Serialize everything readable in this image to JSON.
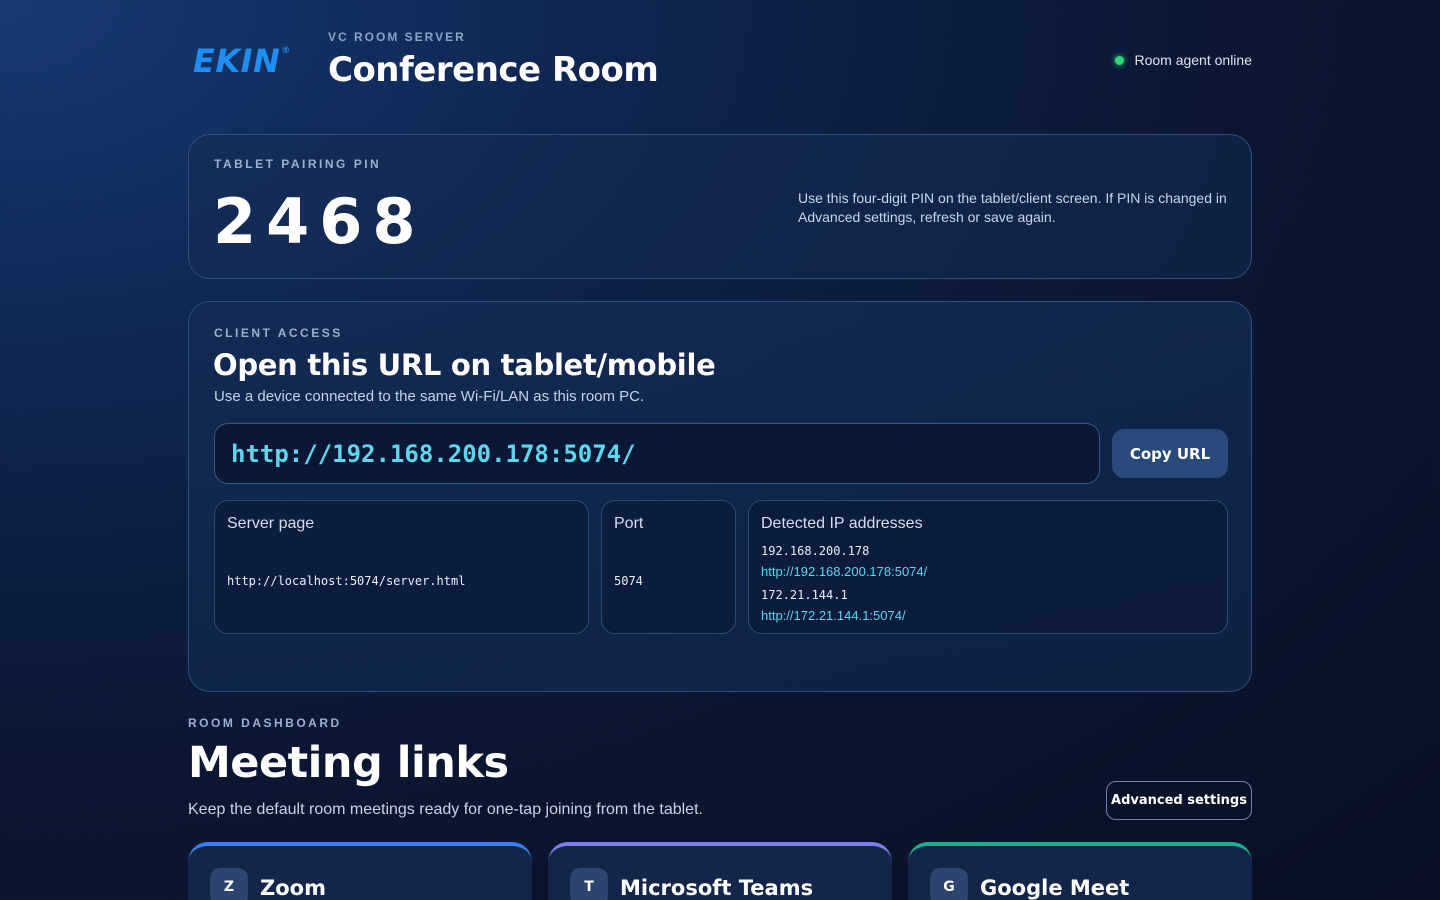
{
  "header": {
    "logo": "EKIN",
    "logo_mark": "®",
    "eyebrow": "VC ROOM SERVER",
    "title": "Conference Room",
    "status": "Room agent online",
    "status_color": "#2ed47a"
  },
  "pin": {
    "label": "TABLET PAIRING PIN",
    "value": "2468",
    "help": "Use this four-digit PIN on the tablet/client screen. If PIN is changed in Advanced settings, refresh or save again."
  },
  "access": {
    "label": "CLIENT ACCESS",
    "title": "Open this URL on tablet/mobile",
    "subtitle": "Use a device connected to the same Wi-Fi/LAN as this room PC.",
    "url": "http://192.168.200.178:5074/",
    "copy_label": "Copy URL",
    "server_page": {
      "title": "Server page",
      "value": "http://localhost:5074/server.html"
    },
    "port": {
      "title": "Port",
      "value": "5074"
    },
    "ips": {
      "title": "Detected IP addresses",
      "entries": [
        {
          "address": "192.168.200.178",
          "link": "http://192.168.200.178:5074/"
        },
        {
          "address": "172.21.144.1",
          "link": "http://172.21.144.1:5074/"
        }
      ]
    }
  },
  "dashboard": {
    "label": "ROOM DASHBOARD",
    "title": "Meeting links",
    "subtitle": "Keep the default room meetings ready for one-tap joining from the tablet.",
    "advanced_label": "Advanced settings",
    "meetings": [
      {
        "badge": "Z",
        "name": "Zoom",
        "accent": "#3b7ff5"
      },
      {
        "badge": "T",
        "name": "Microsoft Teams",
        "accent": "#7c7de8"
      },
      {
        "badge": "G",
        "name": "Google Meet",
        "accent": "#1fae8c"
      }
    ]
  }
}
